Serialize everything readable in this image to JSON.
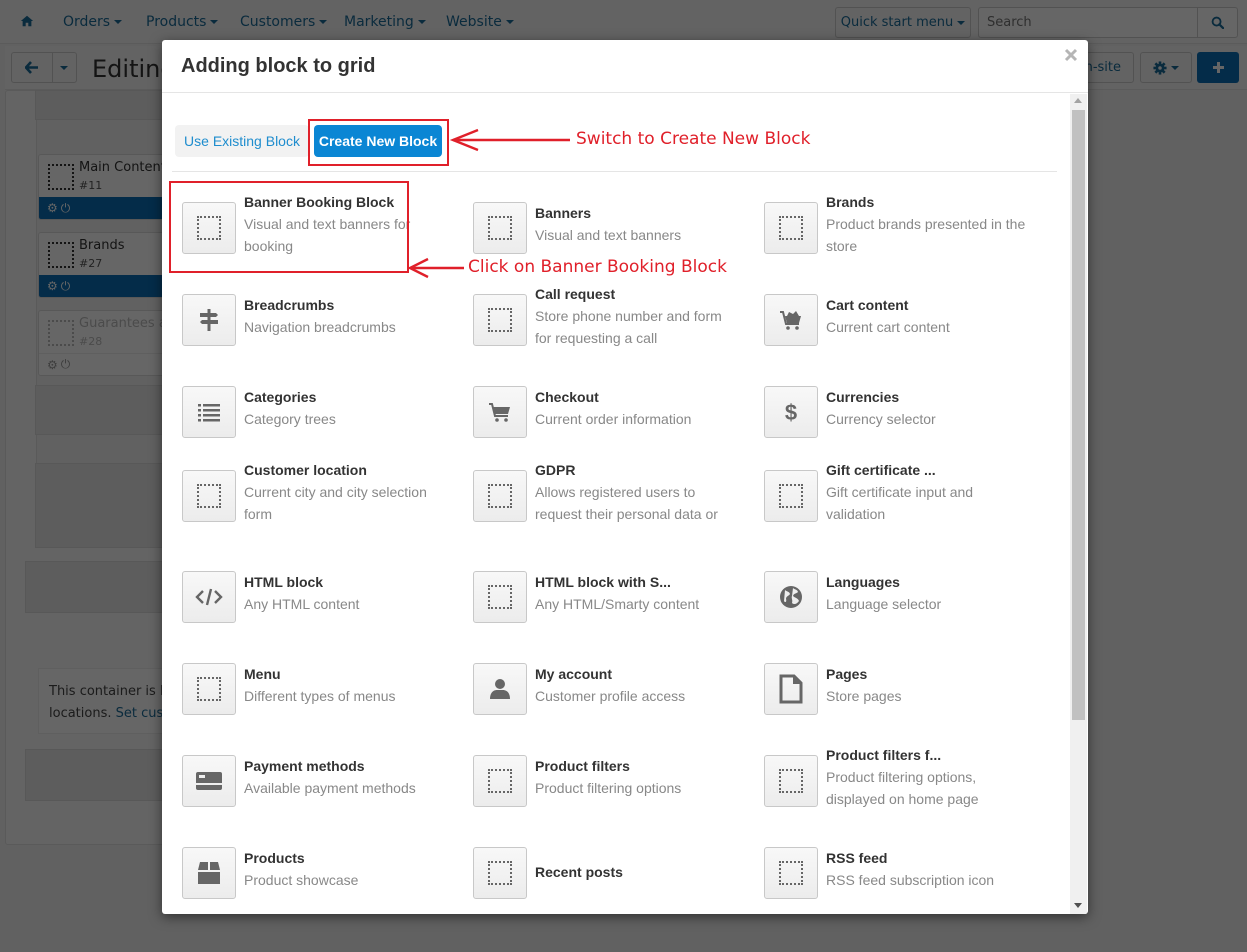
{
  "topnav": {
    "items": [
      {
        "label": "Orders"
      },
      {
        "label": "Products"
      },
      {
        "label": "Customers"
      },
      {
        "label": "Marketing"
      },
      {
        "label": "Website"
      }
    ],
    "quick_start_label": "Quick start menu",
    "search_placeholder": "Search"
  },
  "subbar": {
    "page_title": "Editing",
    "onsite_label": "n-site"
  },
  "layout_panel": {
    "blocks": [
      {
        "name": "Main Content",
        "id": "#11",
        "enabled": true
      },
      {
        "name": "Brands",
        "id": "#27",
        "enabled": true
      },
      {
        "name": "Guarantees an",
        "id": "#28",
        "enabled": false
      }
    ],
    "notice_line1": "This container is NO",
    "notice_line2_prefix": "locations. ",
    "notice_link": "Set custon"
  },
  "modal": {
    "title": "Adding block to grid",
    "tabs": {
      "existing_label": "Use Existing Block",
      "create_label": "Create New Block",
      "active": "create"
    },
    "blocks": [
      {
        "name": "Banner Booking Block",
        "desc": "Visual and text banners for booking",
        "icon": "placeholder-icon"
      },
      {
        "name": "Banners",
        "desc": "Visual and text banners",
        "icon": "placeholder-icon"
      },
      {
        "name": "Brands",
        "desc": "Product brands presented in the store",
        "icon": "placeholder-icon"
      },
      {
        "name": "Breadcrumbs",
        "desc": "Navigation breadcrumbs",
        "icon": "signpost-icon"
      },
      {
        "name": "Call request",
        "desc": "Store phone number and form for requesting a call",
        "icon": "placeholder-icon"
      },
      {
        "name": "Cart content",
        "desc": "Current cart content",
        "icon": "cart-full-icon"
      },
      {
        "name": "Categories",
        "desc": "Category trees",
        "icon": "list-icon"
      },
      {
        "name": "Checkout",
        "desc": "Current order information",
        "icon": "cart-icon"
      },
      {
        "name": "Currencies",
        "desc": "Currency selector",
        "icon": "dollar-icon"
      },
      {
        "name": "Customer location",
        "desc": "Current city and city selection form",
        "icon": "placeholder-icon"
      },
      {
        "name": "GDPR",
        "desc": "Allows registered users to request their personal data or",
        "icon": "placeholder-icon"
      },
      {
        "name": "Gift certificate ...",
        "desc": "Gift certificate input and validation",
        "icon": "placeholder-icon"
      },
      {
        "name": "HTML block",
        "desc": "Any HTML content",
        "icon": "code-icon"
      },
      {
        "name": "HTML block with S...",
        "desc": "Any HTML/Smarty content",
        "icon": "placeholder-icon"
      },
      {
        "name": "Languages",
        "desc": "Language selector",
        "icon": "globe-icon"
      },
      {
        "name": "Menu",
        "desc": "Different types of menus",
        "icon": "placeholder-icon"
      },
      {
        "name": "My account",
        "desc": "Customer profile access",
        "icon": "user-icon"
      },
      {
        "name": "Pages",
        "desc": "Store pages",
        "icon": "page-icon"
      },
      {
        "name": "Payment methods",
        "desc": "Available payment methods",
        "icon": "credit-card-icon"
      },
      {
        "name": "Product filters",
        "desc": "Product filtering options",
        "icon": "placeholder-icon"
      },
      {
        "name": "Product filters f...",
        "desc": "Product filtering options, displayed on home page",
        "icon": "placeholder-icon"
      },
      {
        "name": "Products",
        "desc": "Product showcase",
        "icon": "box-icon"
      },
      {
        "name": "Recent posts",
        "desc": "",
        "icon": "placeholder-icon"
      },
      {
        "name": "RSS feed",
        "desc": "RSS feed subscription icon",
        "icon": "placeholder-icon"
      }
    ]
  },
  "annotations": {
    "switch_note": "Switch to Create New Block",
    "click_note": "Click on Banner Booking Block",
    "color": "#e0202a"
  }
}
